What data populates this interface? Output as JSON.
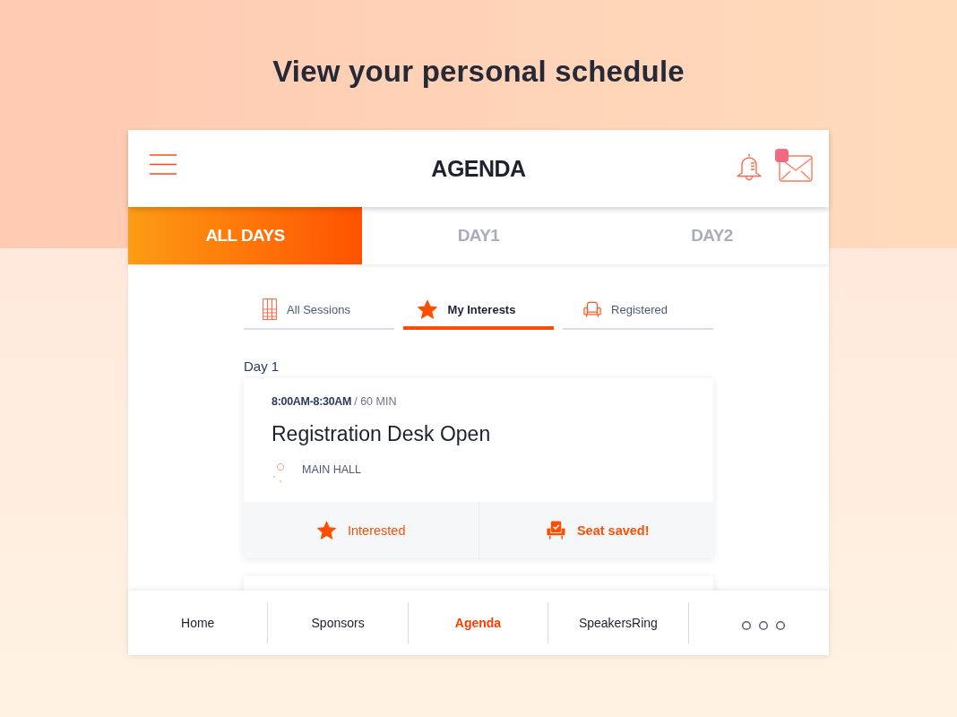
{
  "headline": "View your personal schedule",
  "app_bar": {
    "title": "AGENDA",
    "mail_unread": true
  },
  "day_tabs": [
    {
      "label": "ALL DAYS",
      "selected": true
    },
    {
      "label": "DAY1",
      "selected": false
    },
    {
      "label": "DAY2",
      "selected": false
    }
  ],
  "filter_tabs": [
    {
      "label": "All Sessions",
      "selected": false
    },
    {
      "label": "My Interests",
      "selected": true
    },
    {
      "label": "Registered",
      "selected": false
    }
  ],
  "sections": [
    {
      "heading": "Day 1",
      "sessions": [
        {
          "time": "8:00AM-8:30AM",
          "duration": "/ 60 MIN",
          "title": "Registration Desk Open",
          "location": "MAIN HALL",
          "interested": true,
          "interested_label": "Interested",
          "seat_saved": true,
          "seat_label": "Seat saved!"
        }
      ]
    }
  ],
  "bottom_nav": [
    {
      "label": "Home",
      "selected": false
    },
    {
      "label": "Sponsors",
      "selected": false
    },
    {
      "label": "Agenda",
      "selected": true
    },
    {
      "label": "SpeakersRing",
      "selected": false
    }
  ]
}
